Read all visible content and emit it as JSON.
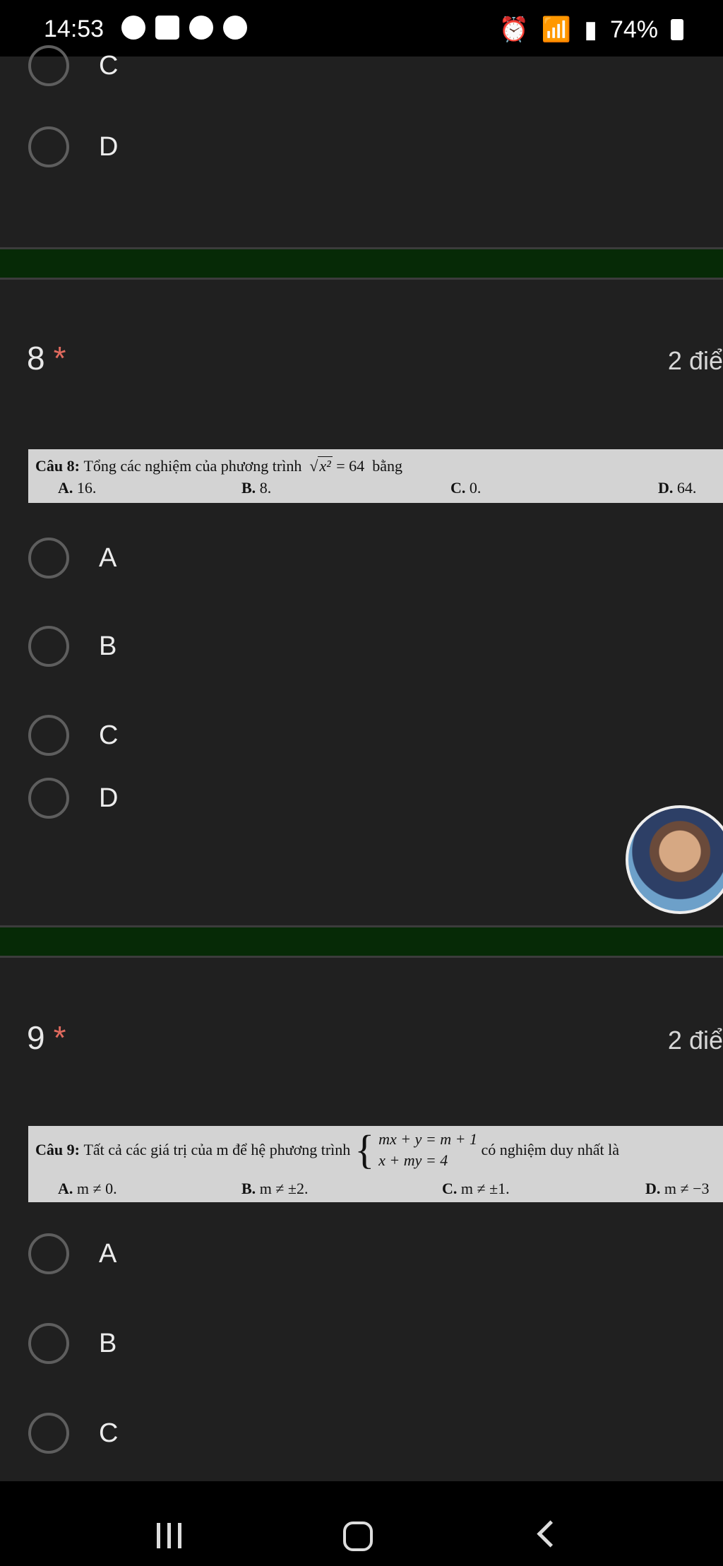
{
  "status_bar": {
    "time": "14:53",
    "battery": "74%"
  },
  "q7_tail": {
    "options": [
      "C",
      "D"
    ]
  },
  "q8": {
    "number": "8",
    "required": "*",
    "points": "2 điể",
    "image": {
      "label": "Câu 8:",
      "stem": "Tổng các nghiệm của phương trình",
      "sqrt_arg": "x²",
      "eq_rest": "= 64",
      "after": "bằng",
      "answers": [
        {
          "key": "A.",
          "text": "16."
        },
        {
          "key": "B.",
          "text": "8."
        },
        {
          "key": "C.",
          "text": "0."
        },
        {
          "key": "D.",
          "text": "64."
        }
      ]
    },
    "options": [
      "A",
      "B",
      "C",
      "D"
    ]
  },
  "q9": {
    "number": "9",
    "required": "*",
    "points": "2 điể",
    "image": {
      "label": "Câu 9:",
      "stem": "Tất cả các giá trị của m để hệ phương trình",
      "brace": "{",
      "eq1": "mx + y = m + 1",
      "eq2": "x + my = 4",
      "after": "có nghiệm duy nhất là",
      "answers": [
        {
          "key": "A.",
          "text": "m ≠ 0."
        },
        {
          "key": "B.",
          "text": "m ≠ ±2."
        },
        {
          "key": "C.",
          "text": "m ≠ ±1."
        },
        {
          "key": "D.",
          "text": "m ≠ −3"
        }
      ]
    },
    "options": [
      "A",
      "B",
      "C"
    ]
  },
  "colors": {
    "background": "#202020",
    "divider": "#062a06",
    "required_star": "#e06a5e"
  },
  "icons": [
    "spotify-icon",
    "flipboard-icon",
    "messenger-icon",
    "lock-icon",
    "alarm-icon",
    "wifi-icon",
    "signal-icon",
    "battery-icon",
    "recent-apps-icon",
    "home-icon",
    "back-icon"
  ]
}
